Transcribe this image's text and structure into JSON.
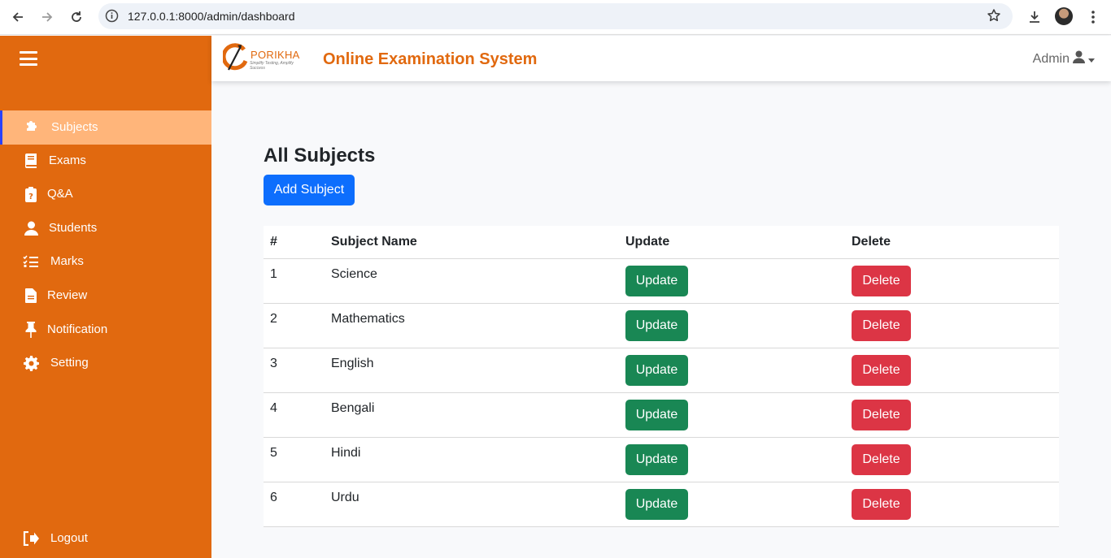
{
  "browser": {
    "url": "127.0.0.1:8000/admin/dashboard"
  },
  "sidebar": {
    "items": [
      {
        "label": "Subjects",
        "icon": "puzzle-icon",
        "active": true
      },
      {
        "label": "Exams",
        "icon": "book-icon",
        "active": false
      },
      {
        "label": "Q&A",
        "icon": "clipboard-question-icon",
        "active": false
      },
      {
        "label": "Students",
        "icon": "user-icon",
        "active": false
      },
      {
        "label": "Marks",
        "icon": "list-check-icon",
        "active": false
      },
      {
        "label": "Review",
        "icon": "file-icon",
        "active": false
      },
      {
        "label": "Notification",
        "icon": "thumbtack-icon",
        "active": false
      },
      {
        "label": "Setting",
        "icon": "gear-icon",
        "active": false
      }
    ],
    "logout_label": "Logout"
  },
  "header": {
    "logo_text": "PORIKHA",
    "logo_tagline": "Simplify Testing, Amplify Success",
    "title": "Online Examination System",
    "user_label": "Admin"
  },
  "main": {
    "title": "All Subjects",
    "add_button_label": "Add Subject",
    "table": {
      "columns": [
        "#",
        "Subject Name",
        "Update",
        "Delete"
      ],
      "rows": [
        {
          "num": "1",
          "name": "Science",
          "update": "Update",
          "delete": "Delete"
        },
        {
          "num": "2",
          "name": "Mathematics",
          "update": "Update",
          "delete": "Delete"
        },
        {
          "num": "3",
          "name": "English",
          "update": "Update",
          "delete": "Delete"
        },
        {
          "num": "4",
          "name": "Bengali",
          "update": "Update",
          "delete": "Delete"
        },
        {
          "num": "5",
          "name": "Hindi",
          "update": "Update",
          "delete": "Delete"
        },
        {
          "num": "6",
          "name": "Urdu",
          "update": "Update",
          "delete": "Delete"
        }
      ]
    }
  },
  "colors": {
    "sidebar": "#e1690f",
    "active_item": "#ffb57a",
    "primary": "#0d6efd",
    "success": "#198754",
    "danger": "#dc3545"
  }
}
